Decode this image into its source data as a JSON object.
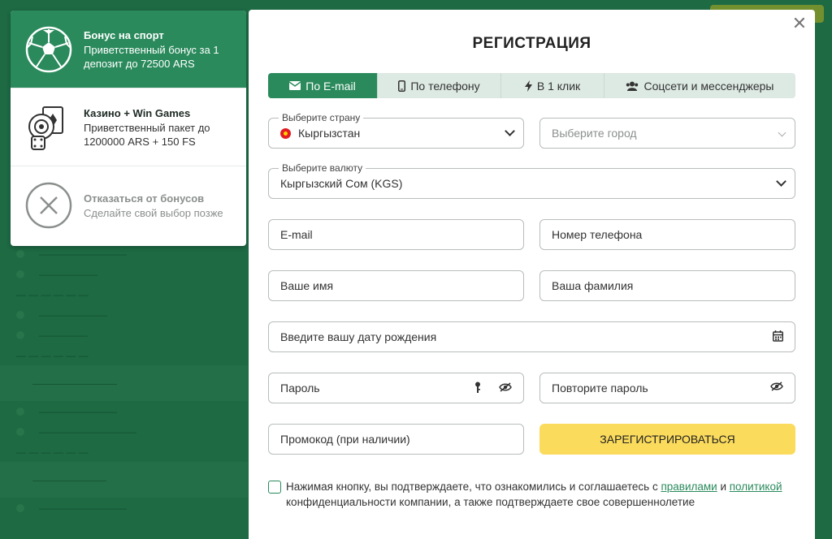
{
  "bonuses": [
    {
      "title": "Бонус на спорт",
      "desc": "Приветственный бонус за 1 депозит до 72500 ARS",
      "icon": "soccer-ball-icon",
      "active": true
    },
    {
      "title": "Казино + Win Games",
      "desc": "Приветственный пакет до 1200000 ARS + 150 FS",
      "icon": "casino-cards-icon",
      "active": false
    },
    {
      "title": "Отказаться от бонусов",
      "desc": "Сделайте свой выбор позже",
      "icon": "decline-x-icon",
      "active": false
    }
  ],
  "modal": {
    "title": "РЕГИСТРАЦИЯ",
    "close": "✕",
    "tabs": [
      {
        "label": "По E-mail",
        "icon": "envelope-icon"
      },
      {
        "label": "По телефону",
        "icon": "mobile-phone-icon"
      },
      {
        "label": "В 1 клик",
        "icon": "lightning-icon"
      },
      {
        "label": "Соцсети и мессенджеры",
        "icon": "users-icon"
      }
    ],
    "country": {
      "label": "Выберите страну",
      "value": "Кыргызстан"
    },
    "city": {
      "placeholder": "Выберите город"
    },
    "currency": {
      "label": "Выберите валюту",
      "value": "Кыргызский Сом (KGS)"
    },
    "email": {
      "placeholder": "E-mail"
    },
    "phone": {
      "placeholder": "Номер телефона"
    },
    "first_name": {
      "placeholder": "Ваше имя"
    },
    "last_name": {
      "placeholder": "Ваша фамилия"
    },
    "birthdate": {
      "placeholder": "Введите вашу дату рождения"
    },
    "password": {
      "placeholder": "Пароль"
    },
    "password_repeat": {
      "placeholder": "Повторите пароль"
    },
    "promo": {
      "placeholder": "Промокод (при наличии)"
    },
    "submit": "ЗАРЕГИСТРИРОВАТЬСЯ",
    "agree": {
      "prefix": "Нажимая кнопку, вы подтверждаете, что ознакомились и соглашаетесь с ",
      "rules_link": "правилами",
      "and": " и ",
      "policy_link": "политикой",
      "suffix": " конфиденциальности компании, а также подтверждаете свое совершеннолетие"
    }
  },
  "colors": {
    "accent": "#2a8a5c",
    "submit": "#fbdb5c",
    "backdrop": "#1d6a43"
  }
}
